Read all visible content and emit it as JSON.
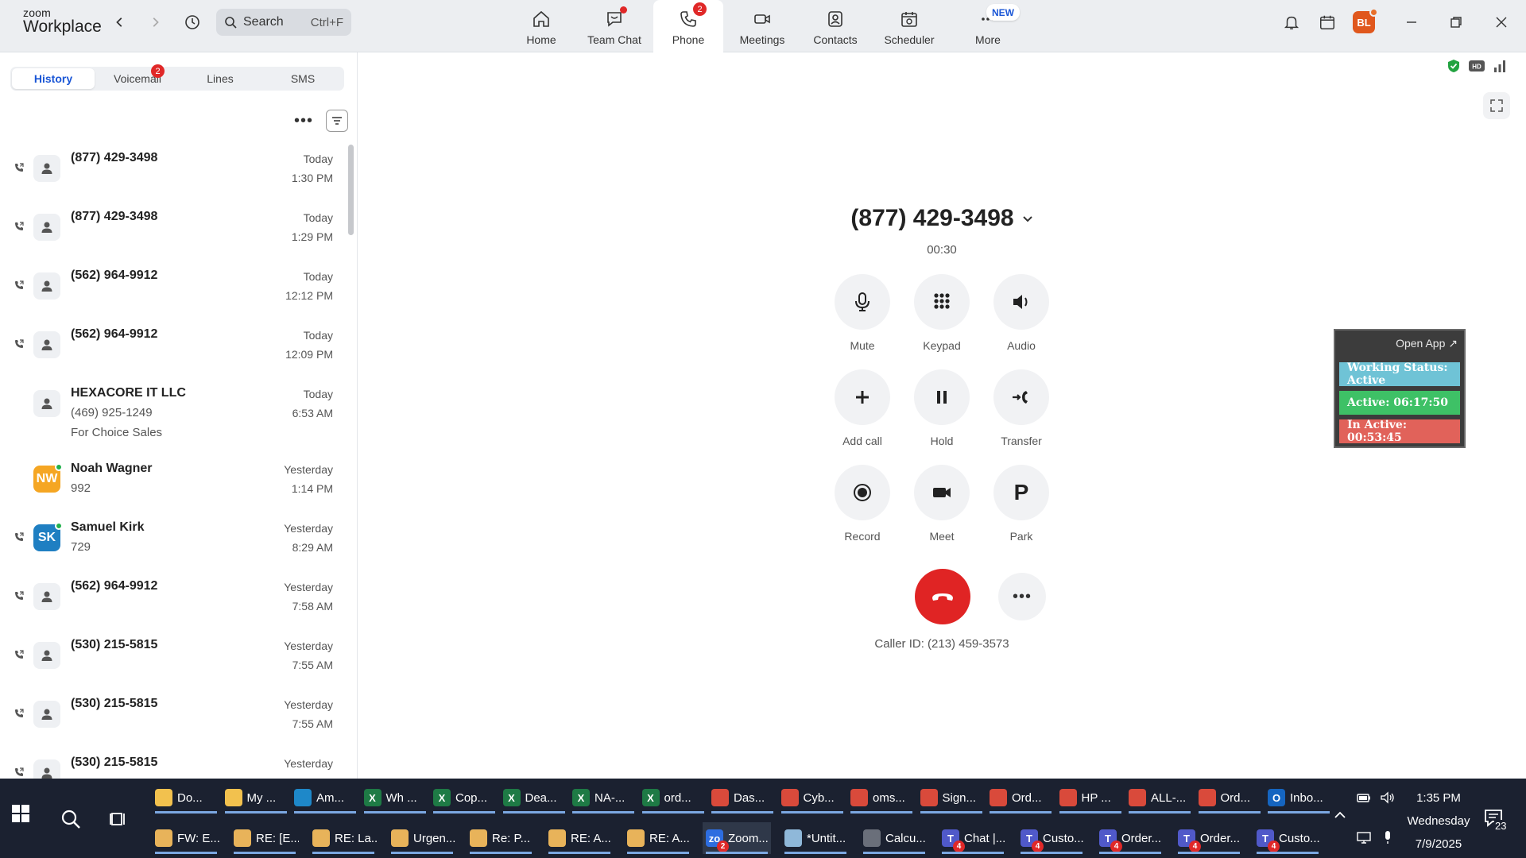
{
  "app": {
    "logo_top": "zoom",
    "logo_bottom": "Workplace",
    "search_label": "Search",
    "search_shortcut": "Ctrl+F",
    "avatar_initials": "BL"
  },
  "nav": {
    "home": "Home",
    "team_chat": "Team Chat",
    "phone": "Phone",
    "phone_badge": "2",
    "meetings": "Meetings",
    "contacts": "Contacts",
    "scheduler": "Scheduler",
    "more": "More",
    "new_badge": "NEW"
  },
  "subtabs": {
    "history": "History",
    "voicemail": "Voicemail",
    "voicemail_badge": "2",
    "lines": "Lines",
    "sms": "SMS"
  },
  "history": [
    {
      "name": "(877) 429-3498",
      "sub": "",
      "sub2": "",
      "day": "Today",
      "time": "1:30 PM"
    },
    {
      "name": "(877) 429-3498",
      "sub": "",
      "sub2": "",
      "day": "Today",
      "time": "1:29 PM"
    },
    {
      "name": "(562) 964-9912",
      "sub": "",
      "sub2": "",
      "day": "Today",
      "time": "12:12 PM"
    },
    {
      "name": "(562) 964-9912",
      "sub": "",
      "sub2": "",
      "day": "Today",
      "time": "12:09 PM"
    },
    {
      "name": "HEXACORE IT LLC",
      "sub": "(469) 925-1249",
      "sub2": "For Choice Sales",
      "day": "Today",
      "time": "6:53 AM"
    },
    {
      "name": "Noah Wagner",
      "sub": "992",
      "sub2": "",
      "day": "Yesterday",
      "time": "1:14 PM",
      "initials": "NW"
    },
    {
      "name": "Samuel Kirk",
      "sub": "729",
      "sub2": "",
      "day": "Yesterday",
      "time": "8:29 AM",
      "initials": "SK"
    },
    {
      "name": "(562) 964-9912",
      "sub": "",
      "sub2": "",
      "day": "Yesterday",
      "time": "7:58 AM"
    },
    {
      "name": "(530) 215-5815",
      "sub": "",
      "sub2": "",
      "day": "Yesterday",
      "time": "7:55 AM"
    },
    {
      "name": "(530) 215-5815",
      "sub": "",
      "sub2": "",
      "day": "Yesterday",
      "time": "7:55 AM"
    },
    {
      "name": "(530) 215-5815",
      "sub": "",
      "sub2": "",
      "day": "Yesterday",
      "time": ""
    }
  ],
  "call": {
    "number": "(877) 429-3498",
    "timer": "00:30",
    "caller_id": "Caller ID: (213) 459-3573",
    "controls": {
      "mute": "Mute",
      "keypad": "Keypad",
      "audio": "Audio",
      "add_call": "Add call",
      "hold": "Hold",
      "transfer": "Transfer",
      "record": "Record",
      "meet": "Meet",
      "park": "Park",
      "park_glyph": "P"
    }
  },
  "widget": {
    "open_app": "Open App ↗",
    "working_status": "Working Status: Active",
    "active": "Active: 06:17:50",
    "inactive": "In Active: 00:53:45"
  },
  "taskbar": {
    "row1": [
      {
        "label": "Do...",
        "icon": "file-explorer-icon",
        "color": "#f2c14e"
      },
      {
        "label": "My ...",
        "icon": "folder-icon",
        "color": "#f2c14e"
      },
      {
        "label": "Am...",
        "icon": "edge-icon",
        "color": "#1e88c9"
      },
      {
        "label": "Wh ...",
        "icon": "excel-icon",
        "color": "#1e7a45"
      },
      {
        "label": "Cop...",
        "icon": "excel-icon",
        "color": "#1e7a45"
      },
      {
        "label": "Dea...",
        "icon": "excel-icon",
        "color": "#1e7a45"
      },
      {
        "label": "NA-...",
        "icon": "excel-icon",
        "color": "#1e7a45"
      },
      {
        "label": "ord...",
        "icon": "excel-icon",
        "color": "#1e7a45"
      },
      {
        "label": "Das...",
        "icon": "chrome-icon",
        "color": "#d94a3b"
      },
      {
        "label": "Cyb...",
        "icon": "chrome-icon",
        "color": "#d94a3b"
      },
      {
        "label": "oms...",
        "icon": "chrome-icon",
        "color": "#d94a3b"
      },
      {
        "label": "Sign...",
        "icon": "chrome-icon",
        "color": "#d94a3b"
      },
      {
        "label": "Ord...",
        "icon": "chrome-icon",
        "color": "#d94a3b"
      },
      {
        "label": "HP ...",
        "icon": "chrome-icon",
        "color": "#d94a3b"
      },
      {
        "label": "ALL-...",
        "icon": "chrome-icon",
        "color": "#d94a3b"
      },
      {
        "label": "Ord...",
        "icon": "chrome-icon",
        "color": "#d94a3b"
      },
      {
        "label": "Inbo...",
        "icon": "outlook-icon",
        "color": "#1565c0"
      }
    ],
    "row2": [
      {
        "label": "FW: E...",
        "icon": "mail-icon",
        "color": "#e8b35a"
      },
      {
        "label": "RE: [E...",
        "icon": "mail-icon",
        "color": "#e8b35a"
      },
      {
        "label": "RE: La...",
        "icon": "mail-icon",
        "color": "#e8b35a"
      },
      {
        "label": "Urgen...",
        "icon": "mail-icon",
        "color": "#e8b35a"
      },
      {
        "label": "Re: P...",
        "icon": "mail-icon",
        "color": "#e8b35a"
      },
      {
        "label": "RE: A...",
        "icon": "mail-icon",
        "color": "#e8b35a"
      },
      {
        "label": "RE: A...",
        "icon": "mail-icon",
        "color": "#e8b35a"
      },
      {
        "label": "Zoom...",
        "icon": "zoom-icon",
        "color": "#2d6de0",
        "count": "2"
      },
      {
        "label": "*Untit...",
        "icon": "notepad-icon",
        "color": "#8fb8d9"
      },
      {
        "label": "Calcu...",
        "icon": "calculator-icon",
        "color": "#6a6f7a"
      },
      {
        "label": "Chat |...",
        "icon": "teams-icon",
        "color": "#5059c9",
        "count": "4"
      },
      {
        "label": "Custo...",
        "icon": "teams-icon",
        "color": "#5059c9",
        "count": "4"
      },
      {
        "label": "Order...",
        "icon": "teams-icon",
        "color": "#5059c9",
        "count": "4"
      },
      {
        "label": "Order...",
        "icon": "teams-icon",
        "color": "#5059c9",
        "count": "4"
      },
      {
        "label": "Custo...",
        "icon": "teams-icon",
        "color": "#5059c9",
        "count": "4"
      }
    ],
    "clock_time": "1:35 PM",
    "clock_day": "Wednesday",
    "clock_date": "7/9/2025",
    "notifications": "23"
  }
}
